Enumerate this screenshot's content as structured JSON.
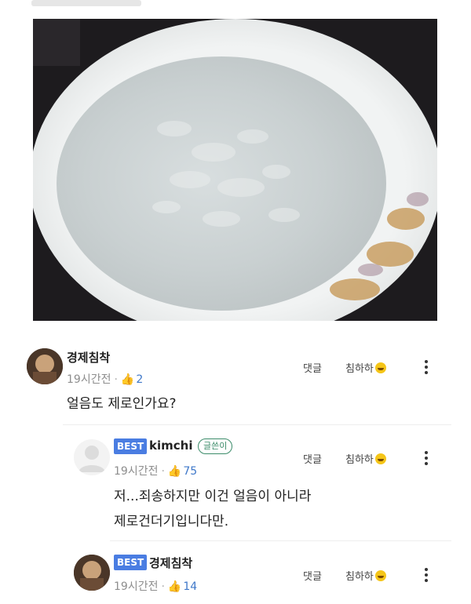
{
  "comments": [
    {
      "author": "경제침착",
      "time": "19시간전",
      "likes": "2",
      "text": "얼음도 제로인가요?",
      "reply_label": "댓글",
      "mock_label": "침하하"
    },
    {
      "best_badge": "BEST",
      "author": "kimchi",
      "writer_badge": "글쓴이",
      "time": "19시간전",
      "likes": "75",
      "text_line1": "저...죄송하지만 이건 얼음이 아니라",
      "text_line2": "제로건더기입니다만.",
      "reply_label": "댓글",
      "mock_label": "침하하"
    },
    {
      "best_badge": "BEST",
      "author": "경제침착",
      "time": "19시간전",
      "likes": "14",
      "reply_label": "댓글",
      "mock_label": "침하하"
    }
  ],
  "colors": {
    "best": "#4a7de2",
    "writer": "#3c8c6a",
    "likes": "#3f78c9"
  },
  "icons": [
    "thumbs-up-icon",
    "laughing-emoji-icon",
    "more-vertical-icon",
    "user-placeholder-icon"
  ]
}
